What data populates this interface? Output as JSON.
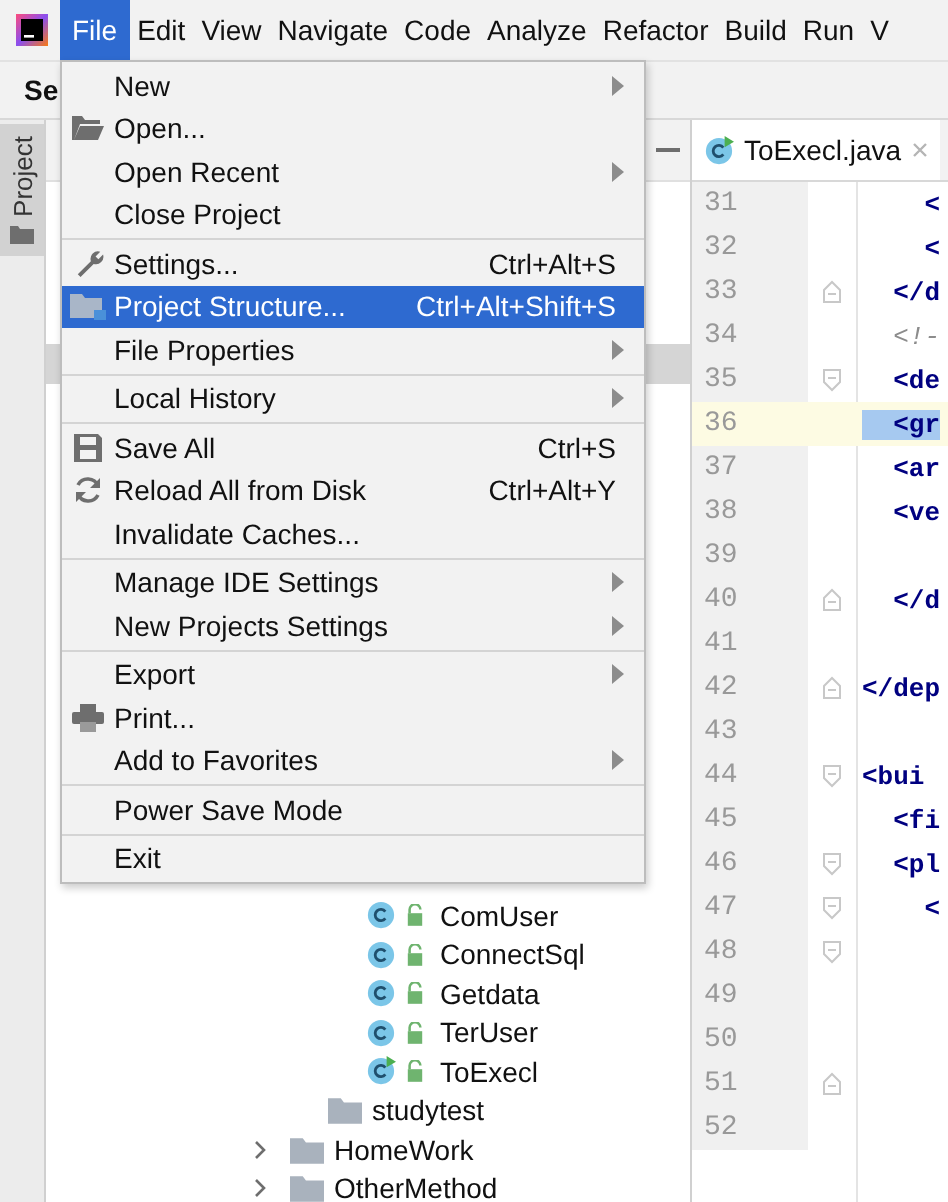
{
  "menu_bar": {
    "items": [
      {
        "label": "File",
        "selected": true
      },
      {
        "label": "Edit",
        "selected": false
      },
      {
        "label": "View",
        "selected": false
      },
      {
        "label": "Navigate",
        "selected": false
      },
      {
        "label": "Code",
        "selected": false
      },
      {
        "label": "Analyze",
        "selected": false
      },
      {
        "label": "Refactor",
        "selected": false
      },
      {
        "label": "Build",
        "selected": false
      },
      {
        "label": "Run",
        "selected": false
      },
      {
        "label": "V",
        "selected": false
      }
    ]
  },
  "toolbar": {
    "title": "Se"
  },
  "tool_strip": {
    "tabs": [
      {
        "label": "Project",
        "selected": true
      }
    ]
  },
  "file_menu": {
    "groups": [
      [
        {
          "label": "New",
          "kind": "plain",
          "submenu": true,
          "selected": false
        },
        {
          "label": "Open...",
          "kind": "open",
          "submenu": false,
          "selected": false
        },
        {
          "label": "Open Recent",
          "kind": "plain",
          "submenu": true,
          "selected": false
        },
        {
          "label": "Close Project",
          "kind": "plain",
          "submenu": false,
          "selected": false
        }
      ],
      [
        {
          "label": "Settings...",
          "kind": "settings",
          "shortcut": "Ctrl+Alt+S",
          "submenu": false,
          "selected": false
        },
        {
          "label": "Project Structure...",
          "kind": "structure",
          "shortcut": "Ctrl+Alt+Shift+S",
          "submenu": false,
          "selected": true
        },
        {
          "label": "File Properties",
          "kind": "plain",
          "submenu": true,
          "selected": false
        }
      ],
      [
        {
          "label": "Local History",
          "kind": "plain",
          "submenu": true,
          "selected": false
        }
      ],
      [
        {
          "label": "Save All",
          "kind": "save",
          "shortcut": "Ctrl+S",
          "submenu": false,
          "selected": false
        },
        {
          "label": "Reload All from Disk",
          "kind": "reload",
          "shortcut": "Ctrl+Alt+Y",
          "submenu": false,
          "selected": false
        },
        {
          "label": "Invalidate Caches...",
          "kind": "plain",
          "submenu": false,
          "selected": false
        }
      ],
      [
        {
          "label": "Manage IDE Settings",
          "kind": "plain",
          "submenu": true,
          "selected": false
        },
        {
          "label": "New Projects Settings",
          "kind": "plain",
          "submenu": true,
          "selected": false
        }
      ],
      [
        {
          "label": "Export",
          "kind": "plain",
          "submenu": true,
          "selected": false
        },
        {
          "label": "Print...",
          "kind": "print",
          "submenu": false,
          "selected": false
        },
        {
          "label": "Add to Favorites",
          "kind": "plain",
          "submenu": true,
          "selected": false
        }
      ],
      [
        {
          "label": "Power Save Mode",
          "kind": "plain",
          "submenu": false,
          "selected": false
        }
      ],
      [
        {
          "label": "Exit",
          "kind": "plain",
          "submenu": false,
          "selected": false
        }
      ]
    ]
  },
  "project_tree": {
    "items": [
      {
        "children": [
          {
            "children": [
              {
                "label": "ComUser",
                "kind": "class"
              },
              {
                "label": "ConnectSql",
                "kind": "class"
              },
              {
                "label": "Getdata",
                "kind": "class"
              },
              {
                "label": "TerUser",
                "kind": "class"
              },
              {
                "label": "ToExecl",
                "kind": "class-main"
              }
            ]
          },
          {
            "label": "studytest",
            "kind": "folder"
          }
        ]
      },
      {
        "label": "HomeWork",
        "kind": "folder",
        "expanded": false
      },
      {
        "label": "OtherMethod",
        "kind": "folder",
        "expanded": false
      }
    ]
  },
  "editor": {
    "tabs": [
      {
        "label": "ToExecl.java",
        "selected": true
      }
    ],
    "lines": [
      {
        "number": "31",
        "text": "    <",
        "kind": "tag",
        "fold_start": false,
        "fold_end": false,
        "current": false
      },
      {
        "number": "32",
        "text": "    <",
        "kind": "tag",
        "fold_start": false,
        "fold_end": false,
        "current": false
      },
      {
        "number": "33",
        "text": "  </d",
        "kind": "tag",
        "fold_start": false,
        "fold_end": true,
        "current": false
      },
      {
        "number": "34",
        "text": "  <!-",
        "kind": "comment",
        "fold_start": false,
        "fold_end": false,
        "current": false
      },
      {
        "number": "35",
        "text": "  <de",
        "kind": "tag",
        "fold_start": true,
        "fold_end": false,
        "current": false
      },
      {
        "number": "36",
        "text": "  <gr",
        "kind": "tag",
        "fold_start": false,
        "fold_end": false,
        "current": true
      },
      {
        "number": "37",
        "text": "  <ar",
        "kind": "tag",
        "fold_start": false,
        "fold_end": false,
        "current": false
      },
      {
        "number": "38",
        "text": "  <ve",
        "kind": "tag",
        "fold_start": false,
        "fold_end": false,
        "current": false
      },
      {
        "number": "39",
        "fold_start": false,
        "fold_end": false,
        "current": false
      },
      {
        "number": "40",
        "text": "  </d",
        "kind": "tag",
        "fold_start": false,
        "fold_end": true,
        "current": false
      },
      {
        "number": "41",
        "fold_start": false,
        "fold_end": false,
        "current": false
      },
      {
        "number": "42",
        "text": "</dep",
        "kind": "tag",
        "fold_start": false,
        "fold_end": true,
        "current": false
      },
      {
        "number": "43",
        "fold_start": false,
        "fold_end": false,
        "current": false
      },
      {
        "number": "44",
        "text": "<bui",
        "kind": "tag",
        "fold_start": true,
        "fold_end": false,
        "current": false
      },
      {
        "number": "45",
        "text": "  <fi",
        "kind": "tag",
        "fold_start": false,
        "fold_end": false,
        "current": false
      },
      {
        "number": "46",
        "text": "  <pl",
        "kind": "tag",
        "fold_start": true,
        "fold_end": false,
        "current": false
      },
      {
        "number": "47",
        "text": "    <",
        "kind": "tag",
        "fold_start": true,
        "fold_end": false,
        "current": false
      },
      {
        "number": "48",
        "fold_start": true,
        "fold_end": false,
        "current": false
      },
      {
        "number": "49",
        "fold_start": false,
        "fold_end": false,
        "current": false
      },
      {
        "number": "50",
        "fold_start": false,
        "fold_end": false,
        "current": false
      },
      {
        "number": "51",
        "fold_start": false,
        "fold_end": true,
        "current": false
      },
      {
        "number": "52",
        "fold_start": false,
        "fold_end": false,
        "current": false
      }
    ]
  }
}
